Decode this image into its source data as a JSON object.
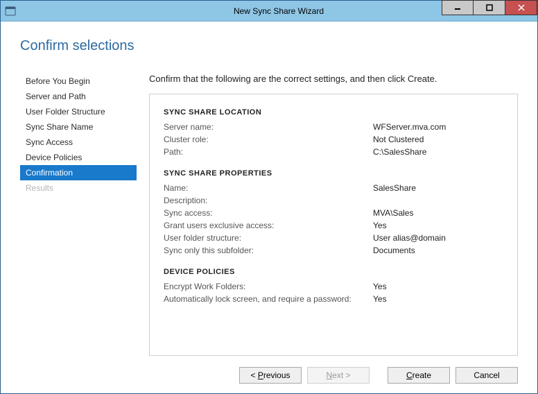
{
  "window": {
    "title": "New Sync Share Wizard"
  },
  "heading": "Confirm selections",
  "steps": [
    {
      "label": "Before You Begin"
    },
    {
      "label": "Server and Path"
    },
    {
      "label": "User Folder Structure"
    },
    {
      "label": "Sync Share Name"
    },
    {
      "label": "Sync Access"
    },
    {
      "label": "Device Policies"
    },
    {
      "label": "Confirmation"
    },
    {
      "label": "Results"
    }
  ],
  "instruction": "Confirm that the following are the correct settings, and then click Create.",
  "sections": {
    "location": {
      "title": "SYNC SHARE LOCATION",
      "server_name_label": "Server name:",
      "server_name_value": "WFServer.mva.com",
      "cluster_role_label": "Cluster role:",
      "cluster_role_value": "Not Clustered",
      "path_label": "Path:",
      "path_value": "C:\\SalesShare"
    },
    "properties": {
      "title": "SYNC SHARE PROPERTIES",
      "name_label": "Name:",
      "name_value": "SalesShare",
      "description_label": "Description:",
      "description_value": "",
      "sync_access_label": "Sync access:",
      "sync_access_value": "MVA\\Sales",
      "exclusive_label": "Grant users exclusive access:",
      "exclusive_value": "Yes",
      "folder_structure_label": "User folder structure:",
      "folder_structure_value": "User alias@domain",
      "subfolder_label": "Sync only this subfolder:",
      "subfolder_value": "Documents"
    },
    "device": {
      "title": "DEVICE POLICIES",
      "encrypt_label": "Encrypt Work Folders:",
      "encrypt_value": "Yes",
      "lock_label": "Automatically lock screen, and require a password:",
      "lock_value": "Yes"
    }
  },
  "buttons": {
    "previous": "< Previous",
    "next": "Next >",
    "create": "Create",
    "cancel": "Cancel"
  }
}
